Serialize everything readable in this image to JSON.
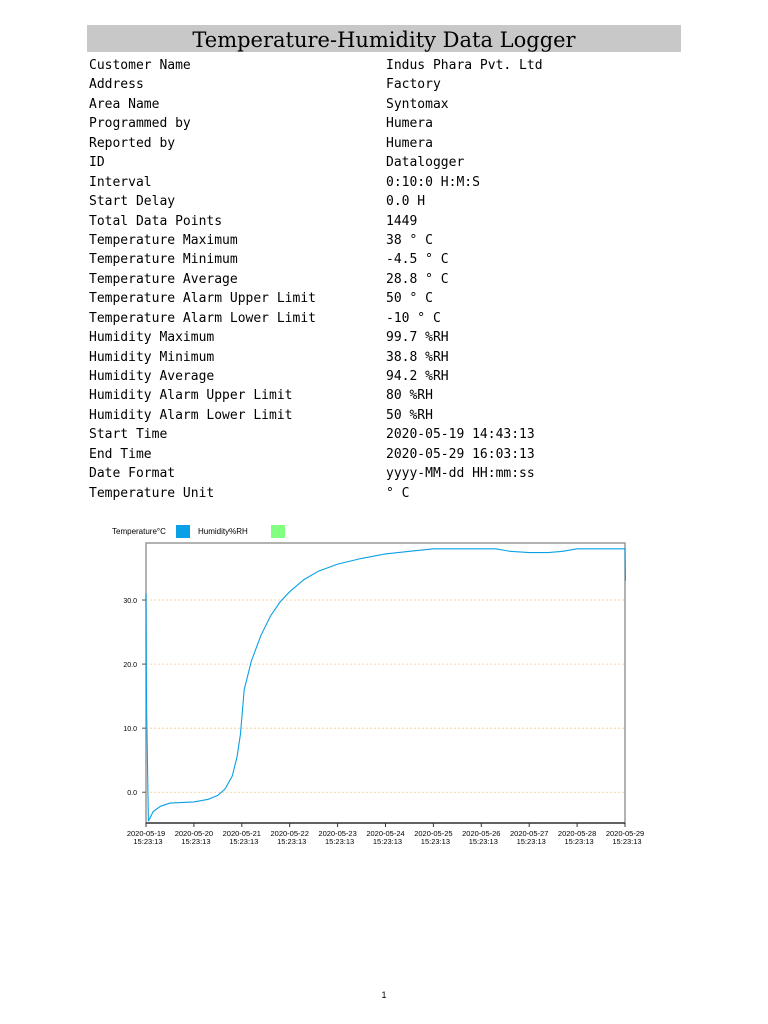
{
  "title": "Temperature-Humidity Data Logger",
  "fields": [
    {
      "k": "Customer Name",
      "v": "Indus Phara Pvt. Ltd"
    },
    {
      "k": "Address",
      "v": "Factory"
    },
    {
      "k": "Area Name",
      "v": "Syntomax"
    },
    {
      "k": "Programmed by",
      "v": "Humera"
    },
    {
      "k": "Reported by",
      "v": "Humera"
    },
    {
      "k": "ID",
      "v": "Datalogger"
    },
    {
      "k": "Interval",
      "v": "0:10:0 H:M:S"
    },
    {
      "k": "Start Delay",
      "v": "0.0 H"
    },
    {
      "k": "Total Data Points",
      "v": "1449"
    },
    {
      "k": "Temperature Maximum",
      "v": "38 ° C"
    },
    {
      "k": "Temperature Minimum",
      "v": "-4.5 ° C"
    },
    {
      "k": "Temperature Average",
      "v": "28.8 ° C"
    },
    {
      "k": "Temperature Alarm Upper Limit",
      "v": "50 ° C"
    },
    {
      "k": "Temperature Alarm Lower Limit",
      "v": "-10 ° C"
    },
    {
      "k": "Humidity Maximum",
      "v": "99.7 %RH"
    },
    {
      "k": "Humidity Minimum",
      "v": "38.8 %RH"
    },
    {
      "k": "Humidity Average",
      "v": "94.2 %RH"
    },
    {
      "k": "Humidity Alarm Upper Limit",
      "v": "80 %RH"
    },
    {
      "k": "Humidity Alarm Lower Limit",
      "v": "50 %RH"
    },
    {
      "k": "Start Time",
      "v": "2020-05-19 14:43:13"
    },
    {
      "k": "End Time",
      "v": "2020-05-29 16:03:13"
    },
    {
      "k": "Date Format",
      "v": "yyyy-MM-dd HH:mm:ss"
    },
    {
      "k": "Temperature Unit",
      "v": "° C"
    }
  ],
  "page_number": "1",
  "chart_data": {
    "type": "line",
    "legend": [
      {
        "name": "Temperature°C",
        "color": "#0aa0e6"
      },
      {
        "name": "Humidity%RH",
        "color": "#80ff80"
      }
    ],
    "legend_placement": "top-left",
    "ylim": [
      -4.8,
      38.9
    ],
    "yticks": [
      "0.0",
      "10.0",
      "20.0",
      "30.0"
    ],
    "ytick_values": [
      0,
      10,
      20,
      30
    ],
    "xticks": [
      [
        "2020-05-19",
        "15:23:13"
      ],
      [
        "2020-05-20",
        "15:23:13"
      ],
      [
        "2020-05-21",
        "15:23:13"
      ],
      [
        "2020-05-22",
        "15:23:13"
      ],
      [
        "2020-05-23",
        "15:23:13"
      ],
      [
        "2020-05-24",
        "15:23:13"
      ],
      [
        "2020-05-25",
        "15:23:13"
      ],
      [
        "2020-05-26",
        "15:23:13"
      ],
      [
        "2020-05-27",
        "15:23:13"
      ],
      [
        "2020-05-28",
        "15:23:13"
      ],
      [
        "2020-05-29",
        "15:23:13"
      ]
    ],
    "xlim_days": [
      0,
      10
    ],
    "series": [
      {
        "name": "Temperature°C",
        "x_days": [
          0,
          0.01,
          0.05,
          0.15,
          0.3,
          0.5,
          1,
          1.3,
          1.5,
          1.65,
          1.8,
          1.9,
          1.97,
          2.05,
          2.2,
          2.4,
          2.6,
          2.8,
          3,
          3.3,
          3.6,
          4,
          4.5,
          5,
          5.5,
          6,
          7,
          7.3,
          7.6,
          8,
          8.4,
          8.7,
          9,
          9.5,
          10,
          10.01
        ],
        "values": [
          31,
          14,
          -4.5,
          -3,
          -2.2,
          -1.7,
          -1.5,
          -1.1,
          -0.5,
          0.5,
          2.5,
          5.5,
          9,
          16,
          20.5,
          24.5,
          27.5,
          29.7,
          31.3,
          33.2,
          34.5,
          35.6,
          36.5,
          37.2,
          37.6,
          38,
          38,
          38,
          37.6,
          37.4,
          37.4,
          37.6,
          38,
          38,
          38,
          33
        ]
      },
      {
        "name": "Humidity%RH",
        "x_days": [],
        "values": []
      }
    ]
  }
}
